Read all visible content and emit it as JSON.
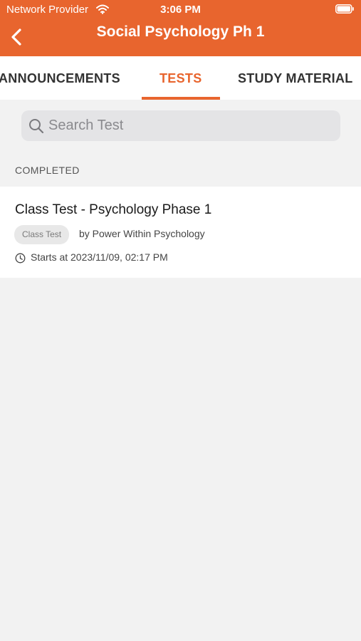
{
  "status_bar": {
    "carrier": "Network Provider",
    "time": "3:06 PM",
    "wifi_icon": "wifi-icon",
    "battery_icon": "battery-icon"
  },
  "header": {
    "title": "Social Psychology Ph 1",
    "back_icon": "chevron-left-icon",
    "background_color": "#e8652e"
  },
  "tabs": [
    {
      "label": "ANNOUNCEMENTS",
      "active": false
    },
    {
      "label": "TESTS",
      "active": true
    },
    {
      "label": "STUDY MATERIAL",
      "active": false
    }
  ],
  "search": {
    "placeholder": "Search Test",
    "value": "",
    "icon": "search-icon"
  },
  "section": {
    "title": "COMPLETED"
  },
  "tests": [
    {
      "title": "Class Test - Psychology Phase 1",
      "tag": "Class Test",
      "author": "by Power Within Psychology",
      "starts": "Starts at 2023/11/09, 02:17 PM",
      "time_icon": "clock-icon"
    }
  ],
  "colors": {
    "accent": "#e8652e",
    "background": "#f2f2f2",
    "card": "#ffffff"
  }
}
